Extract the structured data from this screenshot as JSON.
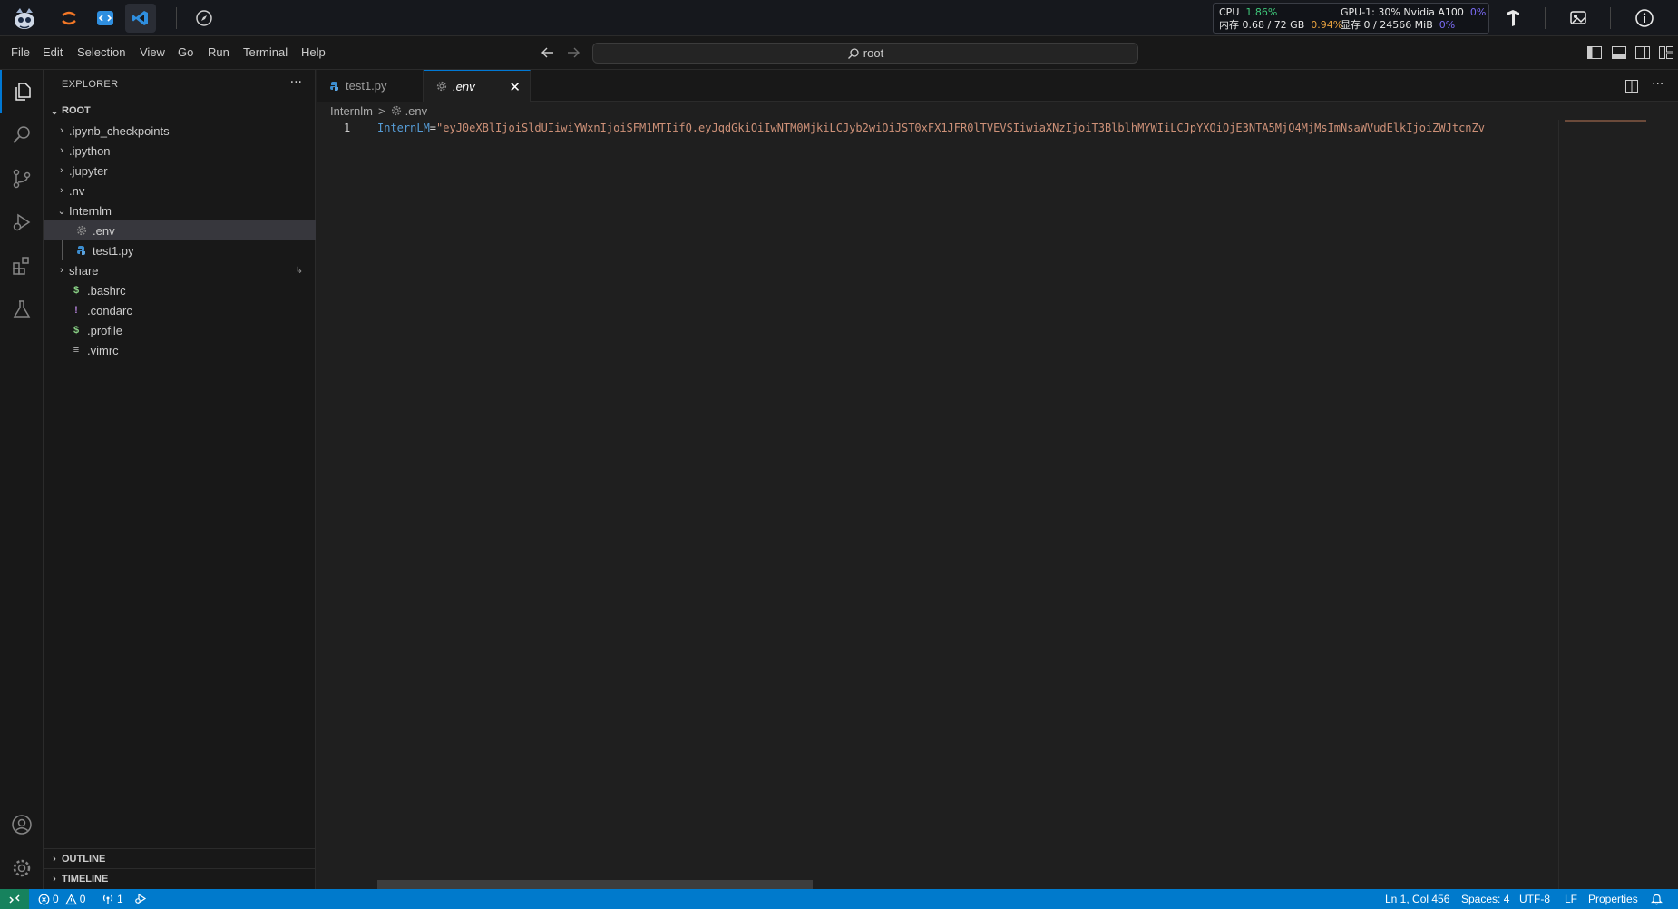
{
  "host": {
    "cpu_label": "CPU",
    "cpu_value": "1.86%",
    "mem_label": "内存 0.68 / 72 GB",
    "mem_value": "0.94%",
    "gpu_label": "GPU-1: 30% Nvidia A100",
    "gpu_value": "0%",
    "vram_label": "显存 0 / 24566 MiB",
    "vram_value": "0%"
  },
  "menu": [
    "File",
    "Edit",
    "Selection",
    "View",
    "Go",
    "Run",
    "Terminal",
    "Help"
  ],
  "command_center": {
    "text": "root"
  },
  "sidebar": {
    "title": "EXPLORER",
    "more": "···",
    "root": "ROOT",
    "items": [
      {
        "label": ".ipynb_checkpoints",
        "type": "folder"
      },
      {
        "label": ".ipython",
        "type": "folder"
      },
      {
        "label": ".jupyter",
        "type": "folder"
      },
      {
        "label": ".nv",
        "type": "folder"
      },
      {
        "label": "Internlm",
        "type": "folder-open"
      },
      {
        "label": ".env",
        "type": "gear"
      },
      {
        "label": "test1.py",
        "type": "python"
      },
      {
        "label": "share",
        "type": "folder"
      },
      {
        "label": ".bashrc",
        "type": "shell"
      },
      {
        "label": ".condarc",
        "type": "yaml"
      },
      {
        "label": ".profile",
        "type": "shell"
      },
      {
        "label": ".vimrc",
        "type": "text"
      }
    ],
    "outline": "OUTLINE",
    "timeline": "TIMELINE"
  },
  "tabs": [
    {
      "label": "test1.py",
      "active": false
    },
    {
      "label": ".env",
      "active": true
    }
  ],
  "breadcrumb": {
    "folder": "Internlm",
    "sep": ">",
    "file": ".env"
  },
  "editor": {
    "line_number": "1",
    "key": "InternLM",
    "eq": "=",
    "value": "\"eyJ0eXBlIjoiSldUIiwiYWxnIjoiSFM1MTIifQ.eyJqdGkiOiIwNTM0MjkiLCJyb2wiOiJST0xFX1JFR0lTVEVSIiwiaXNzIjoiT3BlblhMYWIiLCJpYXQiOjE3NTA5MjQ4MjMsImNsaWVudElkIjoiZWJtcnZv"
  },
  "status": {
    "errors": "0",
    "warnings": "0",
    "ports": "1",
    "position": "Ln 1, Col 456",
    "spaces": "Spaces: 4",
    "encoding": "UTF-8",
    "eol": "LF",
    "language": "Properties"
  }
}
